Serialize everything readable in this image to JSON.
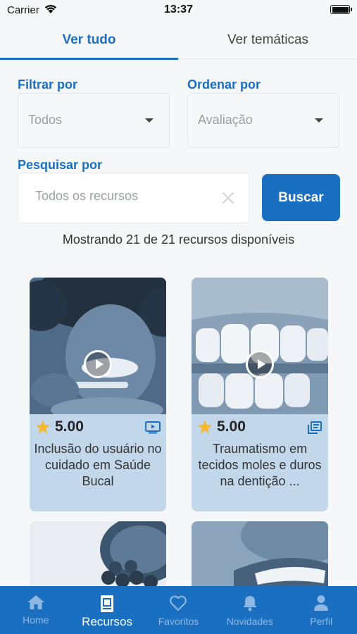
{
  "status_bar": {
    "carrier": "Carrier",
    "time": "13:37"
  },
  "tabs": [
    {
      "label": "Ver tudo",
      "active": true
    },
    {
      "label": "Ver temáticas",
      "active": false
    }
  ],
  "filters": {
    "filter_label": "Filtrar por",
    "filter_value": "Todos",
    "order_label": "Ordenar por",
    "order_value": "Avaliação"
  },
  "search": {
    "label": "Pesquisar por",
    "placeholder": "Todos os recursos",
    "button_label": "Buscar"
  },
  "results_text": "Mostrando 21 de 21 recursos disponíveis",
  "cards": [
    {
      "rating": "5.00",
      "title": "Inclusão do usuário no cuidado em Saúde Bucal",
      "type_icon": "video-icon",
      "media": "video"
    },
    {
      "rating": "5.00",
      "title": "Traumatismo em tecidos moles e duros na dentição ...",
      "type_icon": "pdf-document-icon",
      "media": "video"
    },
    {
      "media": "image"
    },
    {
      "media": "image"
    }
  ],
  "bottom_nav": [
    {
      "label": "Home",
      "icon": "home-icon",
      "active": false
    },
    {
      "label": "Recursos",
      "icon": "resources-icon",
      "active": true
    },
    {
      "label": "Favoritos",
      "icon": "heart-icon",
      "active": false
    },
    {
      "label": "Novidades",
      "icon": "bell-icon",
      "active": false
    },
    {
      "label": "Perfil",
      "icon": "person-icon",
      "active": false
    }
  ],
  "colors": {
    "accent": "#1a6fc0",
    "card_bg": "#c3d7ea",
    "star": "#f5b82e"
  }
}
